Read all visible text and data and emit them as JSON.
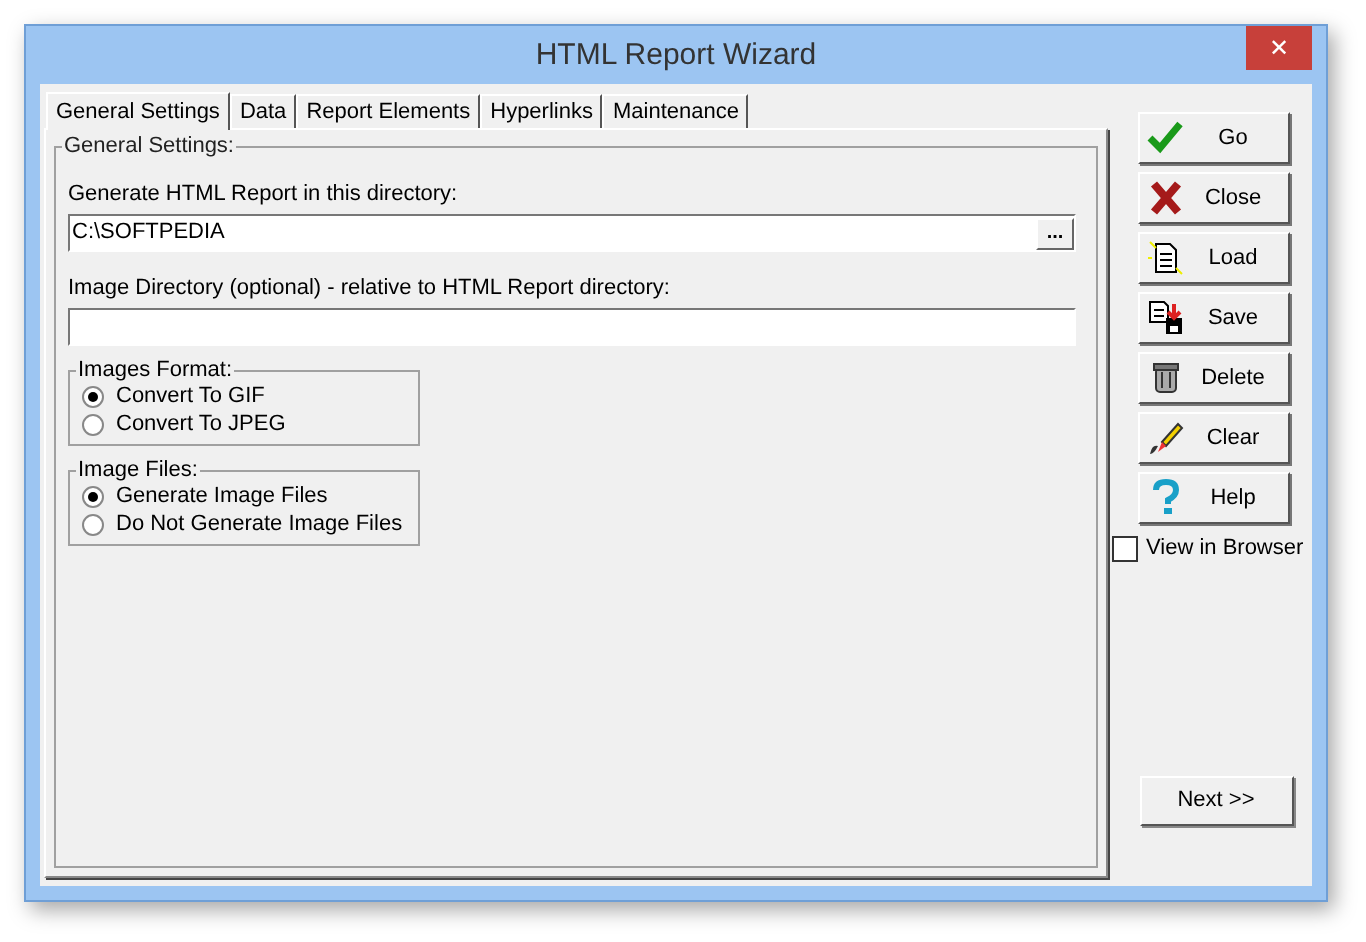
{
  "window": {
    "title": "HTML Report Wizard",
    "close": "✕"
  },
  "tabs": [
    {
      "label": "General Settings",
      "selected": true
    },
    {
      "label": "Data",
      "selected": false
    },
    {
      "label": "Report Elements",
      "selected": false
    },
    {
      "label": "Hyperlinks",
      "selected": false
    },
    {
      "label": "Maintenance",
      "selected": false
    }
  ],
  "general": {
    "title": "General Settings:",
    "directory_label": "Generate HTML Report in this directory:",
    "directory_value": "C:\\SOFTPEDIA",
    "browse": "...",
    "image_dir_label": "Image Directory (optional) - relative to HTML Report directory:",
    "groups": [
      {
        "title": "Images Format:",
        "options": [
          {
            "label": "Convert To GIF",
            "selected": true
          },
          {
            "label": "Convert To JPEG",
            "selected": false
          }
        ]
      },
      {
        "title": "Image Files:",
        "options": [
          {
            "label": "Generate Image Files",
            "selected": true
          },
          {
            "label": "Do Not Generate Image Files",
            "selected": false
          }
        ]
      }
    ]
  },
  "buttons": [
    {
      "label": "Go"
    },
    {
      "label": "Close"
    },
    {
      "label": "Load"
    },
    {
      "label": "Save"
    },
    {
      "label": "Delete"
    },
    {
      "label": "Clear"
    },
    {
      "label": "Help"
    }
  ],
  "view_in_browser": {
    "label": "View in Browser",
    "checked": false
  },
  "next": "Next >>"
}
